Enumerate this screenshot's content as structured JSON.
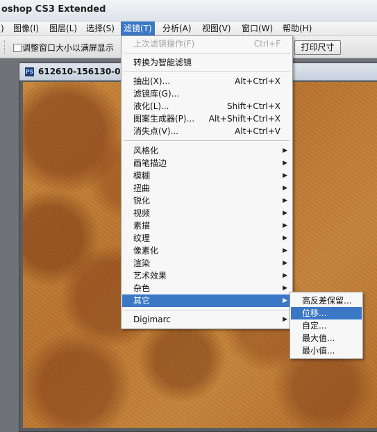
{
  "window": {
    "title": "oshop CS3 Extended"
  },
  "menubar": {
    "items": [
      {
        "label": ")"
      },
      {
        "label": "图像(I)"
      },
      {
        "label": "图层(L)"
      },
      {
        "label": "选择(S)"
      },
      {
        "label": "滤镜(T)"
      },
      {
        "label": "分析(A)"
      },
      {
        "label": "视图(V)"
      },
      {
        "label": "窗口(W)"
      },
      {
        "label": "帮助(H)"
      }
    ],
    "active": "滤镜(T)"
  },
  "options_bar": {
    "resize_windows_label": "调整窗口大小以满屏显示",
    "resize_windows_checked": false,
    "print_size_button": "打印尺寸"
  },
  "document": {
    "title": "612610-156130-00",
    "icon": "PS"
  },
  "filter_menu": {
    "items": [
      {
        "label": "上次滤镜操作(F)",
        "shortcut": "Ctrl+F",
        "disabled": true
      },
      {
        "label": "转换为智能滤镜"
      },
      {
        "label": "抽出(X)...",
        "shortcut": "Alt+Ctrl+X"
      },
      {
        "label": "滤镜库(G)..."
      },
      {
        "label": "液化(L)...",
        "shortcut": "Shift+Ctrl+X"
      },
      {
        "label": "图案生成器(P)...",
        "shortcut": "Alt+Shift+Ctrl+X"
      },
      {
        "label": "消失点(V)...",
        "shortcut": "Alt+Ctrl+V"
      },
      {
        "label": "风格化"
      },
      {
        "label": "画笔描边"
      },
      {
        "label": "模糊"
      },
      {
        "label": "扭曲"
      },
      {
        "label": "锐化"
      },
      {
        "label": "视频"
      },
      {
        "label": "素描"
      },
      {
        "label": "纹理"
      },
      {
        "label": "像素化"
      },
      {
        "label": "渲染"
      },
      {
        "label": "艺术效果"
      },
      {
        "label": "杂色"
      },
      {
        "label": "其它",
        "highlighted": true
      },
      {
        "label": "Digimarc"
      }
    ]
  },
  "other_submenu": {
    "items": [
      {
        "label": "高反差保留..."
      },
      {
        "label": "位移...",
        "highlighted": true
      },
      {
        "label": "自定..."
      },
      {
        "label": "最大值..."
      },
      {
        "label": "最小值..."
      }
    ]
  },
  "icons": {
    "submenu_arrow": "triangle-right-icon",
    "doc_icon": "photoshop-file-icon",
    "checkbox": "checkbox-icon"
  },
  "colors": {
    "highlight": "#3a78c6",
    "menu_bg": "#f7f7f7",
    "disabled_text": "#a6a6a6"
  }
}
